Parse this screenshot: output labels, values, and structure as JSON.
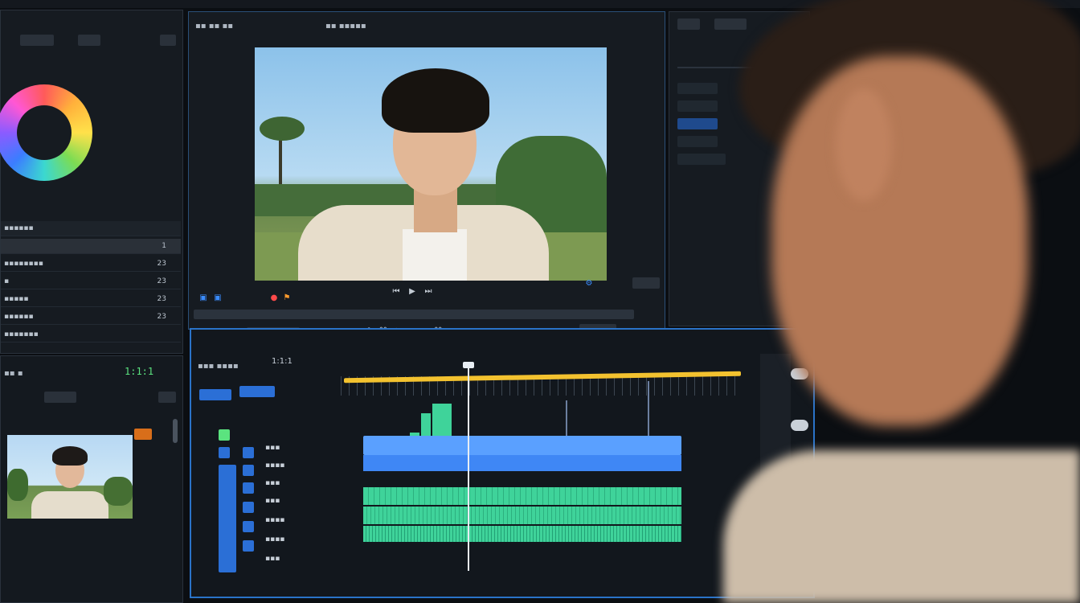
{
  "timeline": {
    "timecode": "1:1:1"
  },
  "preview": {
    "duration": "1:1:1"
  },
  "left_panel": {
    "values": [
      "1",
      "23",
      "23",
      "23",
      "23"
    ]
  },
  "colors": {
    "accent": "#2b6fd6",
    "green_audio": "#3fd39a",
    "blue_track": "#5aa0ff",
    "timeline_yellow": "#f3c22f",
    "panel_bg": "#1a1f26",
    "window_bg": "#0b0e12"
  },
  "icons": {
    "play": "play-icon",
    "pause": "pause-icon",
    "scissors": "scissors-icon",
    "color_wheel": "color-wheel-icon",
    "gear": "gear-icon"
  }
}
